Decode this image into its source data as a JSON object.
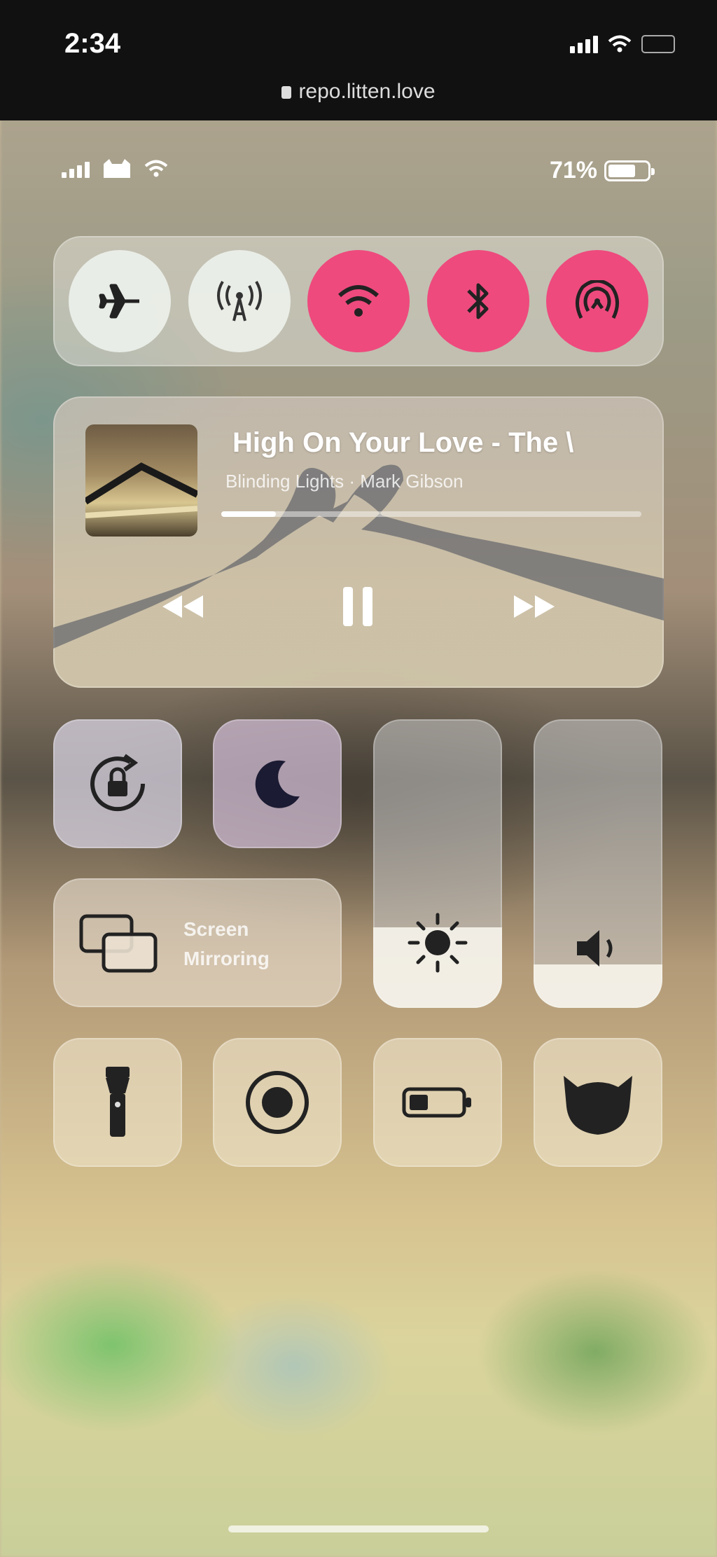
{
  "browser": {
    "time": "2:34",
    "url": "repo.litten.love"
  },
  "status_bar": {
    "battery_percent": "71%",
    "battery_level": 0.71
  },
  "connectivity": {
    "buttons": [
      {
        "name": "airplane-mode",
        "icon": "airplane-icon",
        "state": "off"
      },
      {
        "name": "cellular-data",
        "icon": "antenna-icon",
        "state": "off"
      },
      {
        "name": "wifi",
        "icon": "wifi-icon",
        "state": "on"
      },
      {
        "name": "bluetooth",
        "icon": "bluetooth-icon",
        "state": "on"
      },
      {
        "name": "airdrop",
        "icon": "airdrop-icon",
        "state": "on"
      }
    ],
    "active_color": "#ee4a7e"
  },
  "media": {
    "title": "High On Your Love - The \\",
    "subtitle": "Blinding Lights · Mark Gibson",
    "progress": 0.13,
    "controls": [
      "rewind-icon",
      "pause-icon",
      "fast-forward-icon"
    ]
  },
  "tiles": {
    "rotation_lock": "rotation-lock-icon",
    "do_not_disturb": "moon-icon",
    "brightness_level": 0.28,
    "volume_level": 0.15,
    "screen_mirroring": {
      "line1": "Screen",
      "line2": "Mirroring"
    },
    "bottom_row": [
      "flashlight-icon",
      "screen-record-icon",
      "low-power-icon",
      "cat-app-icon"
    ]
  }
}
